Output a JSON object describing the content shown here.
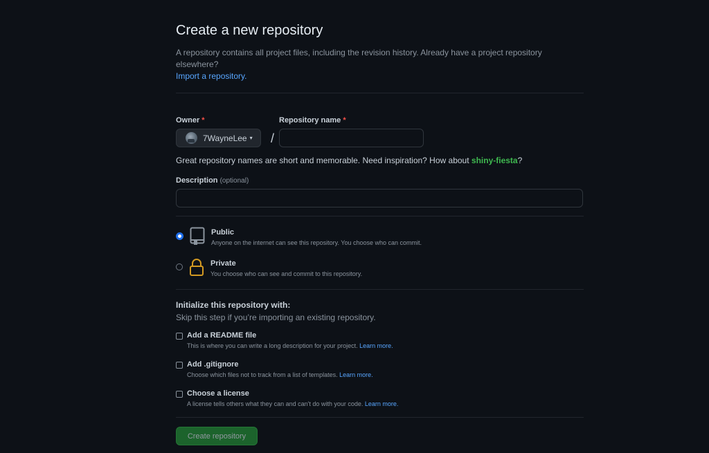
{
  "header": {
    "title": "Create a new repository",
    "subtitle": "A repository contains all project files, including the revision history. Already have a project repository elsewhere?",
    "import_link": "Import a repository."
  },
  "owner": {
    "label": "Owner",
    "required_mark": "*",
    "value": "7WayneLee",
    "caret": "▾"
  },
  "repo_name": {
    "label": "Repository name",
    "required_mark": "*",
    "value": ""
  },
  "separator": "/",
  "name_hint": {
    "text": "Great repository names are short and memorable. Need inspiration? How about",
    "suggestion": "shiny-fiesta",
    "end": "?"
  },
  "description": {
    "label": "Description",
    "optional": "(optional)",
    "value": ""
  },
  "visibility": {
    "selected": "public",
    "options": [
      {
        "id": "public",
        "title": "Public",
        "desc": "Anyone on the internet can see this repository. You choose who can commit.",
        "icon": "repo-icon"
      },
      {
        "id": "private",
        "title": "Private",
        "desc": "You choose who can see and commit to this repository.",
        "icon": "lock-icon"
      }
    ]
  },
  "init": {
    "title": "Initialize this repository with:",
    "subtitle": "Skip this step if you’re importing an existing repository.",
    "options": [
      {
        "title": "Add a README file",
        "desc": "This is where you can write a long description for your project.",
        "link": "Learn more.",
        "checked": false
      },
      {
        "title": "Add .gitignore",
        "desc": "Choose which files not to track from a list of templates.",
        "link": "Learn more.",
        "checked": false
      },
      {
        "title": "Choose a license",
        "desc": "A license tells others what they can and can't do with your code.",
        "link": "Learn more.",
        "checked": false
      }
    ]
  },
  "submit": {
    "label": "Create repository"
  },
  "colors": {
    "background": "#0d1117",
    "accent": "#238636",
    "link": "#58a6ff",
    "suggestion": "#3fb950",
    "lock": "#d29922"
  }
}
